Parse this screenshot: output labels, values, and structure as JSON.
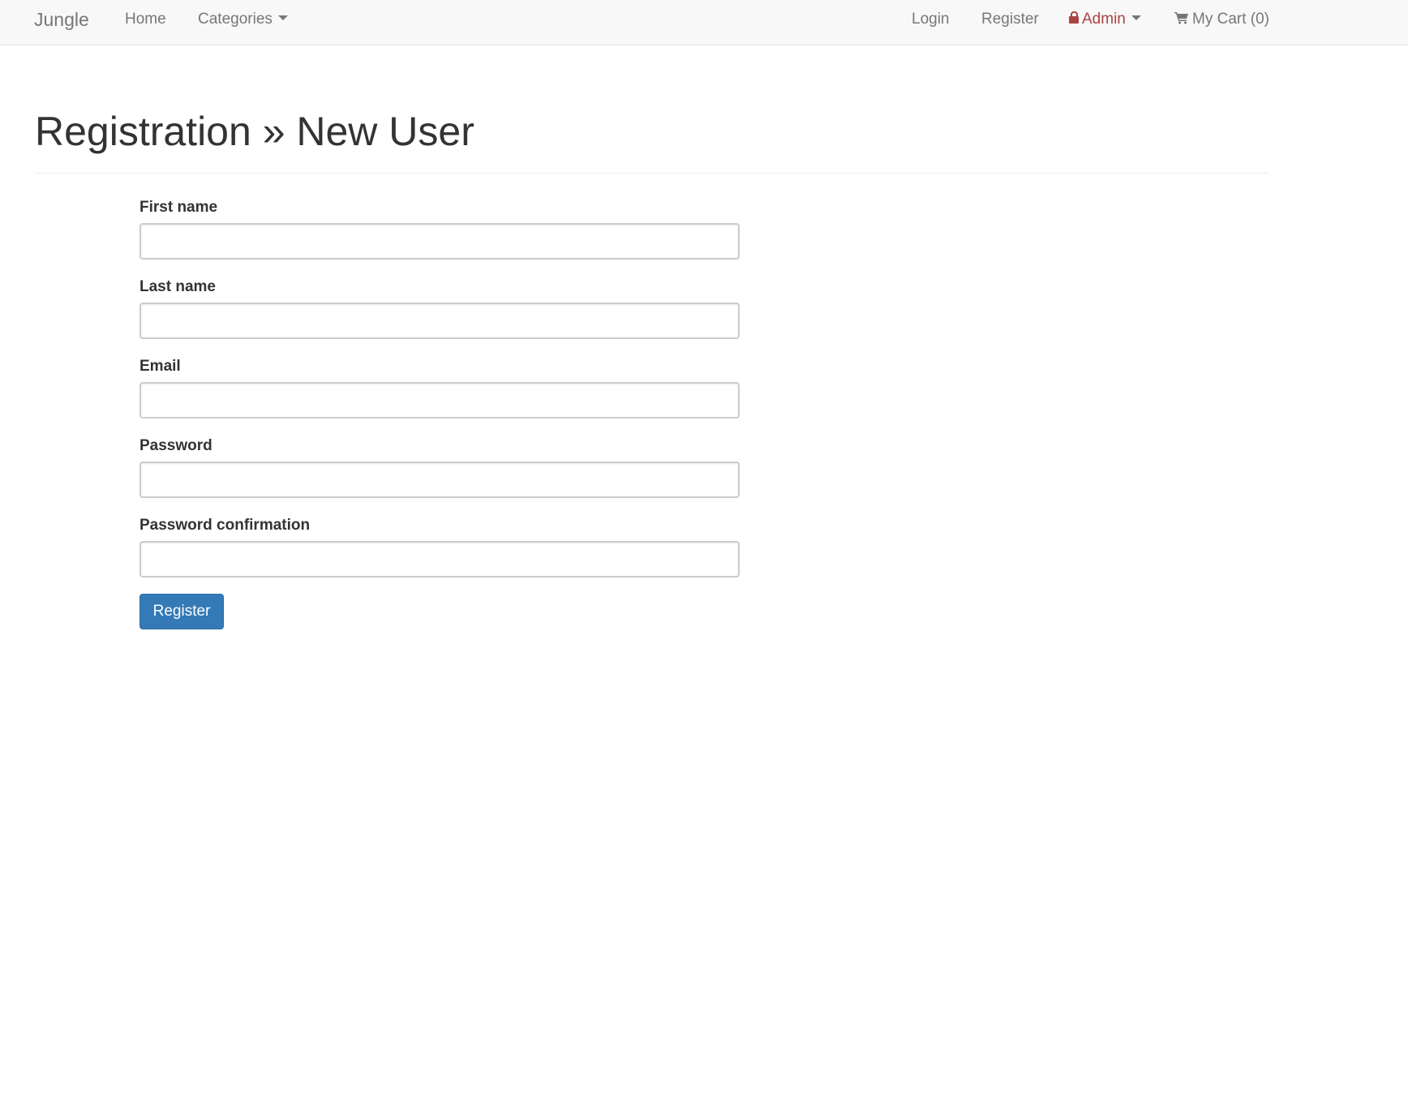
{
  "navbar": {
    "brand": "Jungle",
    "home": "Home",
    "categories": "Categories",
    "login": "Login",
    "register": "Register",
    "admin": "Admin",
    "cart": "My Cart (0)",
    "admin_color": "#a94442"
  },
  "page": {
    "title": "Registration » New User"
  },
  "form": {
    "first_name": {
      "label": "First name",
      "value": ""
    },
    "last_name": {
      "label": "Last name",
      "value": ""
    },
    "email": {
      "label": "Email",
      "value": ""
    },
    "password": {
      "label": "Password",
      "value": ""
    },
    "password_confirmation": {
      "label": "Password confirmation",
      "value": ""
    },
    "submit_label": "Register",
    "submit_color": "#337ab7"
  },
  "icons": {
    "categories_caret": "caret-down-icon",
    "admin_lock": "lock-icon",
    "admin_caret": "caret-down-icon",
    "cart": "shopping-cart-icon"
  }
}
